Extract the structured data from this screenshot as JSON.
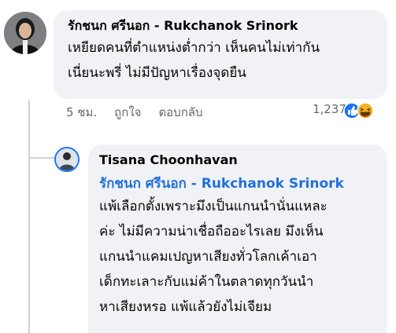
{
  "main_comment": {
    "author": "รักชนก ศรีนอก - Rukchanok Srinork",
    "lines": [
      "เหยียดคนที่ตำแหน่งต่ำกว่า เห็นคนไม่เท่ากัน",
      "เนี่ยนะพรี่ ไม่มีปัญหาเรื่องจุดยืน"
    ],
    "actions": {
      "time": "5 ชม.",
      "like": "ถูกใจ",
      "reply": "ตอบกลับ"
    },
    "reaction_count": "1,237",
    "reactions": [
      "like-icon",
      "haha-icon"
    ]
  },
  "reply_comment": {
    "author": "Tisana Choonhavan",
    "mention": "รักชนก ศรีนอก - Rukchanok Srinork",
    "lines": [
      "แพ้เลือกตั้งเพราะมึงเป็นแกนนำนั่นแหละ",
      "ค่ะ ไม่มีความน่าเชื่อถืออะไรเลย มึงเห็น",
      "แกนนำแคมเปญหาเสียงทั่วโลกเค้าเอา",
      "เด็กทะเลาะกับแม่ค้าในตลาดทุกวันนำ",
      "หาเสียงหรอ แพ้แล้วยังไม่เจียม"
    ]
  },
  "colors": {
    "bubble": "#f0f2f5",
    "mention": "#216fdb",
    "meta": "#65676b",
    "like_blue": "#1877f2",
    "haha_yellow": "#f7b125"
  }
}
